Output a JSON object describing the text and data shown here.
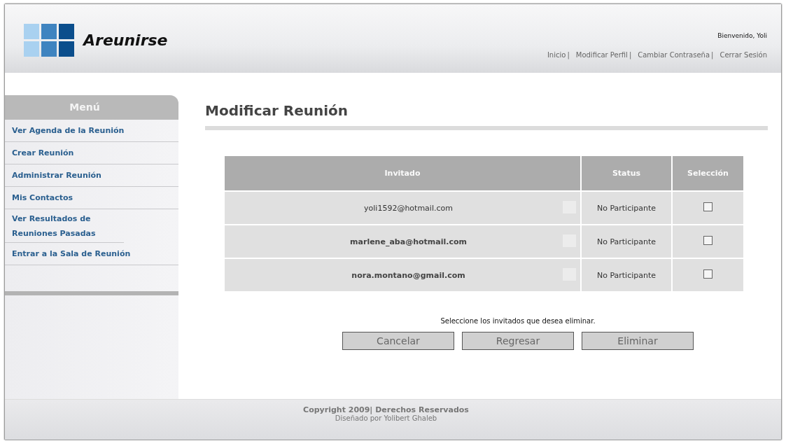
{
  "header": {
    "logo_text": "Areunirse",
    "welcome": "Bienvenido, Yoli",
    "nav_separator": "|",
    "nav": [
      "Inicio",
      "Modificar Perfil",
      "Cambiar Contraseña",
      "Cerrar Sesión"
    ]
  },
  "sidebar": {
    "title": "Menú",
    "items": [
      {
        "label": "Ver Agenda de la Reunión"
      },
      {
        "label": "Crear Reunión"
      },
      {
        "label": "Administrar Reunión"
      },
      {
        "label": "Mis Contactos"
      },
      {
        "label": "Ver Resultados de Reuniones Pasadas"
      },
      {
        "label": "Entrar a la Sala de Reunión"
      }
    ]
  },
  "page_title": "Modificar Reunión",
  "table": {
    "columns": [
      "Invitado",
      "Status",
      "Selección"
    ],
    "rows": [
      {
        "invitado": "yoli1592@hotmail.com",
        "bold": false,
        "status": "No Participante",
        "checked": false
      },
      {
        "invitado": "marlene_aba@hotmail.com",
        "bold": true,
        "status": "No Participante",
        "checked": false
      },
      {
        "invitado": "nora.montano@gmail.com",
        "bold": true,
        "status": "No Participante",
        "checked": false
      }
    ]
  },
  "instruction": "Seleccione los invitados que desea eliminar.",
  "buttons": [
    "Cancelar",
    "Regresar",
    "Eliminar"
  ],
  "footer": {
    "copyright": "Copyright 2009| Derechos Reservados",
    "credit": "Diseñado por Yolibert Ghaleb"
  }
}
